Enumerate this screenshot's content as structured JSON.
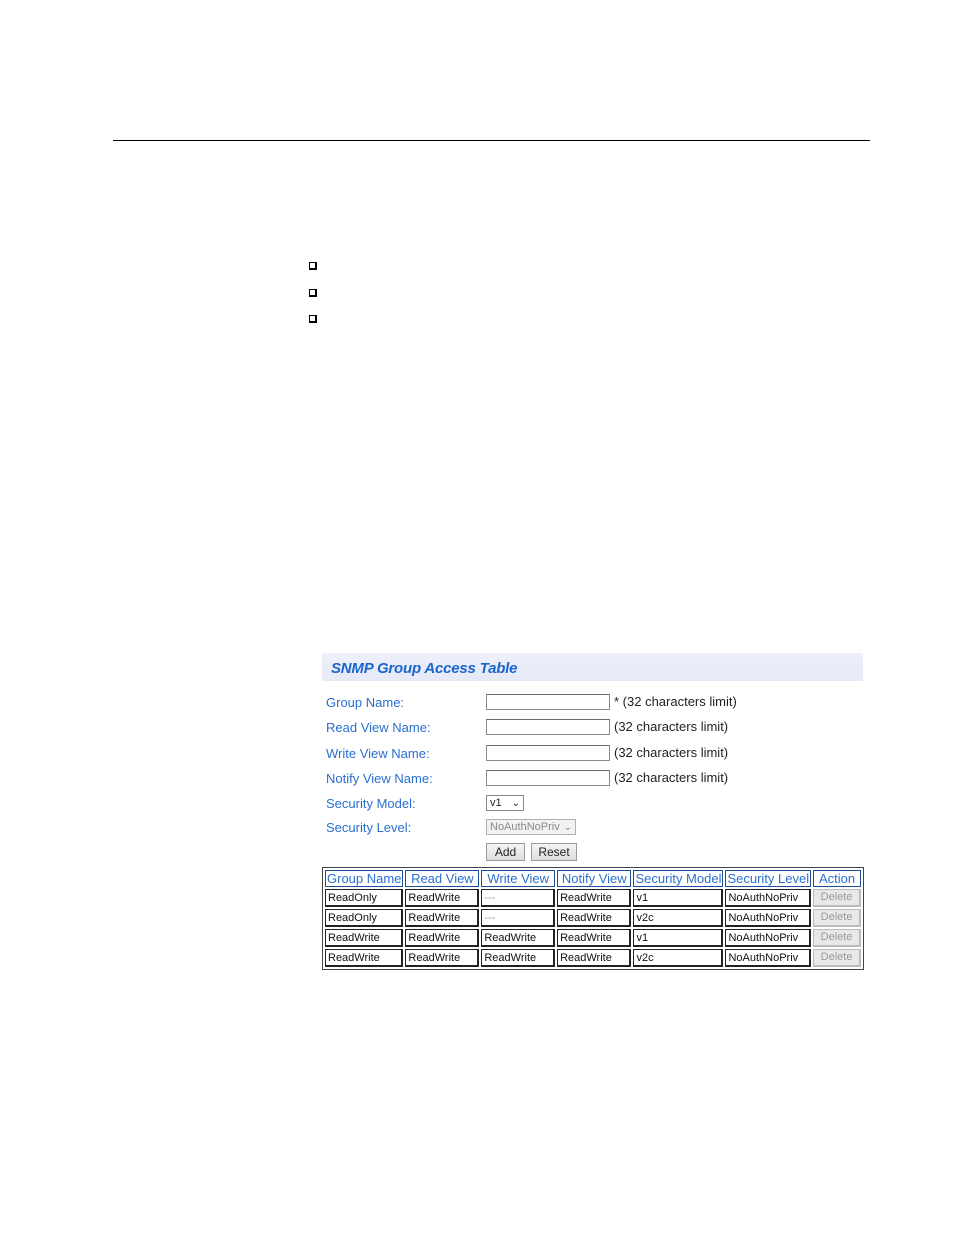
{
  "document": {
    "bullets": [
      "",
      "",
      ""
    ]
  },
  "panel": {
    "title": "SNMP Group Access Table",
    "form": {
      "group_name": {
        "label": "Group Name:",
        "value": "",
        "limit": "* (32 characters limit)"
      },
      "read_view": {
        "label": "Read View Name:",
        "value": "",
        "limit": "(32 characters limit)"
      },
      "write_view": {
        "label": "Write View Name:",
        "value": "",
        "limit": "(32 characters limit)"
      },
      "notify_view": {
        "label": "Notify View Name:",
        "value": "",
        "limit": "(32 characters limit)"
      },
      "security_model": {
        "label": "Security Model:",
        "selected": "v1"
      },
      "security_level": {
        "label": "Security Level:",
        "selected": "NoAuthNoPriv",
        "disabled": true
      },
      "add_label": "Add",
      "reset_label": "Reset"
    },
    "table": {
      "headers": [
        "Group Name",
        "Read View",
        "Write View",
        "Notify View",
        "Security Model",
        "Security Level",
        "Action"
      ],
      "rows": [
        {
          "group": "ReadOnly",
          "read": "ReadWrite",
          "write": "---",
          "notify": "ReadWrite",
          "model": "v1",
          "level": "NoAuthNoPriv",
          "action": "Delete"
        },
        {
          "group": "ReadOnly",
          "read": "ReadWrite",
          "write": "---",
          "notify": "ReadWrite",
          "model": "v2c",
          "level": "NoAuthNoPriv",
          "action": "Delete"
        },
        {
          "group": "ReadWrite",
          "read": "ReadWrite",
          "write": "ReadWrite",
          "notify": "ReadWrite",
          "model": "v1",
          "level": "NoAuthNoPriv",
          "action": "Delete"
        },
        {
          "group": "ReadWrite",
          "read": "ReadWrite",
          "write": "ReadWrite",
          "notify": "ReadWrite",
          "model": "v2c",
          "level": "NoAuthNoPriv",
          "action": "Delete"
        }
      ]
    }
  },
  "colors": {
    "label_blue": "#2a6fd0",
    "title_blue": "#1a66cc",
    "band_bg": "#e8ebf8"
  }
}
